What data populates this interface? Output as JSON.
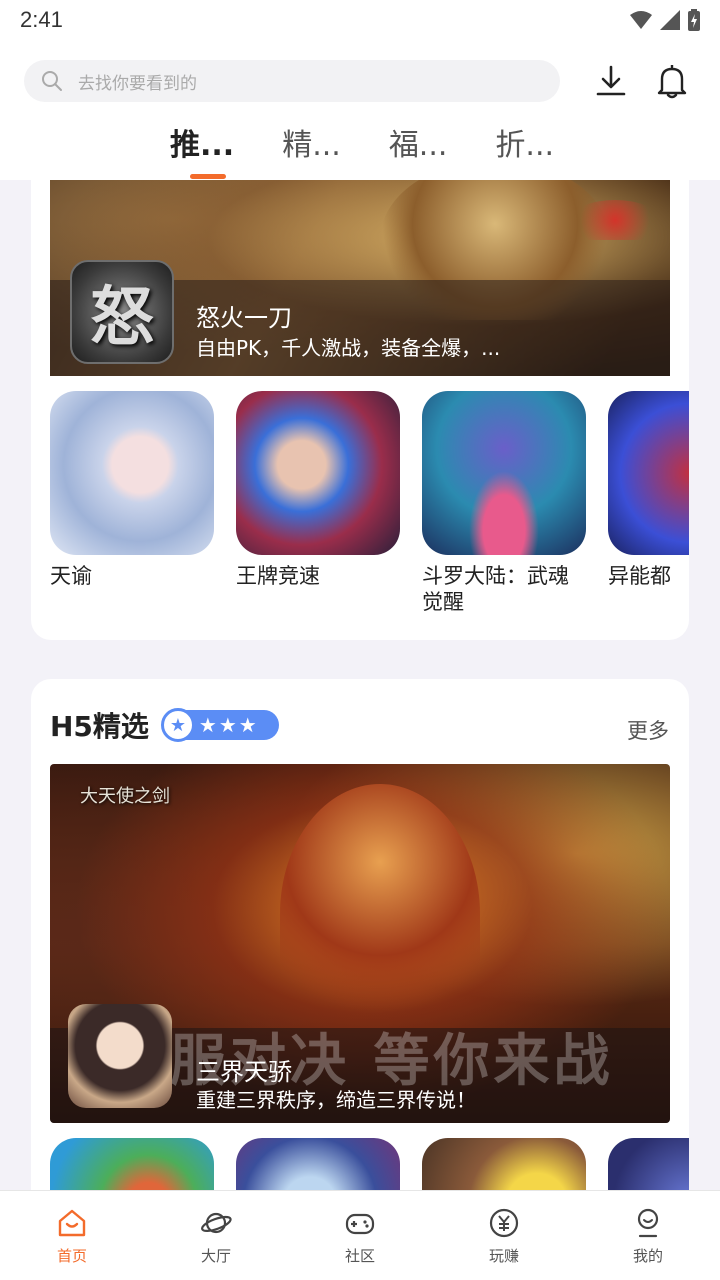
{
  "status_bar": {
    "time": "2:41"
  },
  "header": {
    "search_placeholder": "去找你要看到的",
    "tabs": [
      {
        "label": "推...",
        "active": true
      },
      {
        "label": "精...",
        "active": false
      },
      {
        "label": "福...",
        "active": false
      },
      {
        "label": "折...",
        "active": false
      }
    ]
  },
  "recommend_section": {
    "featured": {
      "icon_char": "怒",
      "title": "怒火一刀",
      "desc": "自由PK，千人激战，装备全爆，..."
    },
    "games": [
      {
        "name": "天谕"
      },
      {
        "name": "王牌竞速"
      },
      {
        "name": "斗罗大陆：武魂觉醒"
      },
      {
        "name": "异能都"
      }
    ]
  },
  "h5_section": {
    "title": "H5精选",
    "stars": "★★★",
    "first_star": "★",
    "more": "更多",
    "banner_logo": "大天使之剑",
    "banner_caption": "服对决 等你来战",
    "featured": {
      "title": "三界天骄",
      "desc": "重建三界秩序，缔造三界传说！"
    }
  },
  "bottom_nav": [
    {
      "label": "首页",
      "active": true
    },
    {
      "label": "大厅",
      "active": false
    },
    {
      "label": "社区",
      "active": false
    },
    {
      "label": "玩赚",
      "active": false
    },
    {
      "label": "我的",
      "active": false
    }
  ],
  "colors": {
    "accent": "#f36b2b",
    "badge": "#5b8df5"
  }
}
